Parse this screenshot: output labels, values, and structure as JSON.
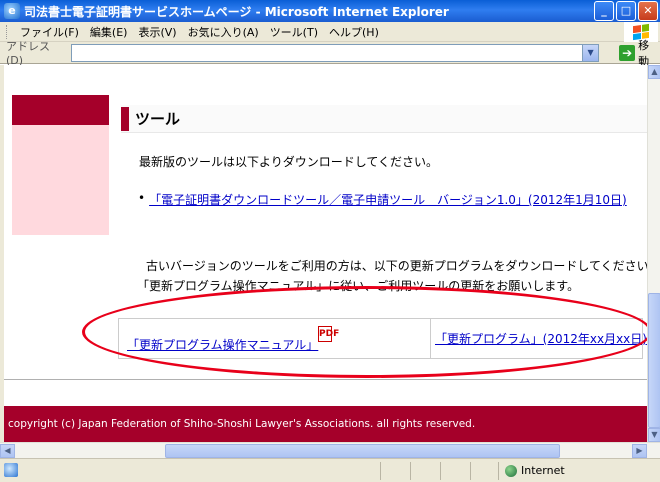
{
  "window": {
    "title": "司法書士電子証明書サービスホームページ - Microsoft Internet Explorer",
    "minimize": "_",
    "maximize": "□",
    "close": "✕"
  },
  "menu": {
    "items": [
      "ファイル(F)",
      "編集(E)",
      "表示(V)",
      "お気に入り(A)",
      "ツール(T)",
      "ヘルプ(H)"
    ]
  },
  "address": {
    "label": "アドレス(D)",
    "value": "",
    "go_label": "移動"
  },
  "page": {
    "heading": "ツール",
    "intro": "最新版のツールは以下よりダウンロードしてください。",
    "bullet_link": "「電子証明書ダウンロードツール／電子申請ツール　バージョン1.0」(2012年1月10日)",
    "para1": "古いバージョンのツールをご利用の方は、以下の更新プログラムをダウンロードしてください。",
    "para2": "「更新プログラム操作マニュアル」に従い、ご利用ツールの更新をお願いします。",
    "manual_link": "「更新プログラム操作マニュアル」",
    "pdf_badge": "PDF",
    "update_link": "「更新プログラム」(2012年xx月xx日)",
    "footer": "copyright (c) Japan Federation of Shiho-Shoshi Lawyer's Associations. all rights reserved."
  },
  "status": {
    "zone": "Internet"
  },
  "colors": {
    "brand_red": "#a5002a",
    "link": "#0000c8",
    "callout": "#e8001a"
  }
}
